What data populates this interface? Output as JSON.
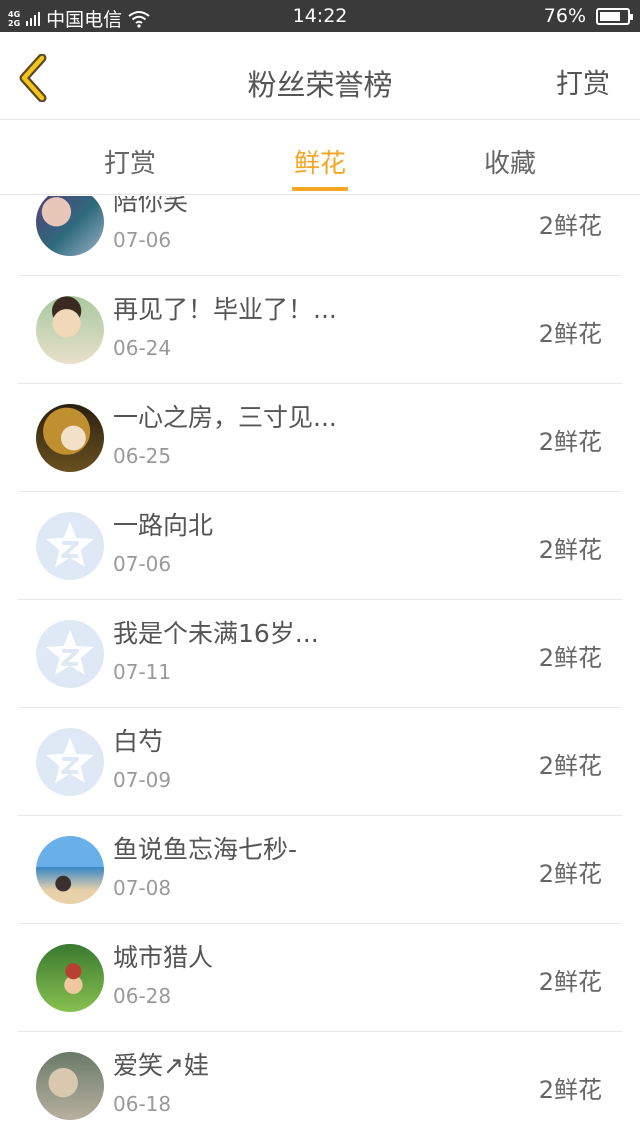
{
  "status_bar": {
    "network": [
      "4G",
      "2G"
    ],
    "carrier": "中国电信",
    "time": "14:22",
    "battery": "76%",
    "battery_level": 0.76
  },
  "nav": {
    "title": "粉丝荣誉榜",
    "right_action": "打赏"
  },
  "tabs": [
    {
      "label": "打赏",
      "active": false
    },
    {
      "label": "鲜花",
      "active": true
    },
    {
      "label": "收藏",
      "active": false
    }
  ],
  "list": [
    {
      "name": "陪你笑",
      "date": "07-06",
      "count": "2鲜花",
      "avatar": "photo"
    },
    {
      "name": "再见了！毕业了！...",
      "date": "06-24",
      "count": "2鲜花",
      "avatar": "photo"
    },
    {
      "name": "一心之房，三寸见...",
      "date": "06-25",
      "count": "2鲜花",
      "avatar": "photo"
    },
    {
      "name": "一路向北",
      "date": "07-06",
      "count": "2鲜花",
      "avatar": "qzone-star-icon"
    },
    {
      "name": "我是个未满16岁...",
      "date": "07-11",
      "count": "2鲜花",
      "avatar": "qzone-star-icon"
    },
    {
      "name": "白芍",
      "date": "07-09",
      "count": "2鲜花",
      "avatar": "qzone-star-icon"
    },
    {
      "name": "鱼说鱼忘海七秒-",
      "date": "07-08",
      "count": "2鲜花",
      "avatar": "photo"
    },
    {
      "name": "城市猎人",
      "date": "06-28",
      "count": "2鲜花",
      "avatar": "photo"
    },
    {
      "name": "爱笑↗娃",
      "date": "06-18",
      "count": "2鲜花",
      "avatar": "photo"
    }
  ],
  "colors": {
    "accent": "#f5a623",
    "status_bar": "#3a3a3a",
    "text": "#555555",
    "subtext": "#9a9a9a",
    "divider": "#e8e8e8",
    "placeholder_avatar": "#dfe9f5"
  }
}
